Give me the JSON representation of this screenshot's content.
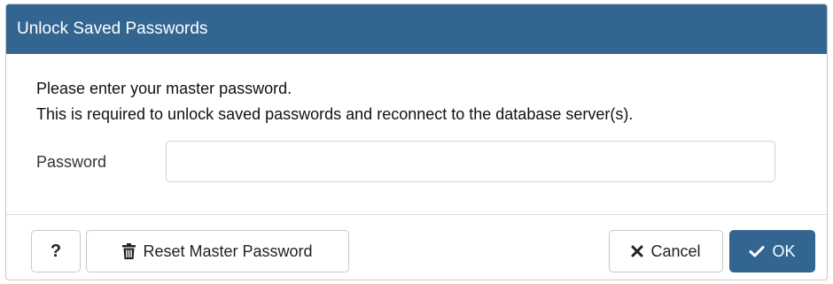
{
  "dialog": {
    "title": "Unlock Saved Passwords",
    "message_line1": "Please enter your master password.",
    "message_line2": "This is required to unlock saved passwords and reconnect to the database server(s).",
    "password_label": "Password",
    "password_value": "",
    "password_placeholder": ""
  },
  "buttons": {
    "help_label": "?",
    "reset_label": "Reset Master Password",
    "cancel_label": "Cancel",
    "ok_label": "OK"
  },
  "icons": {
    "reset": "trash-icon",
    "cancel": "close-icon",
    "ok": "checkmark-icon"
  },
  "colors": {
    "primary": "#326690",
    "title_text": "#ffffff"
  }
}
